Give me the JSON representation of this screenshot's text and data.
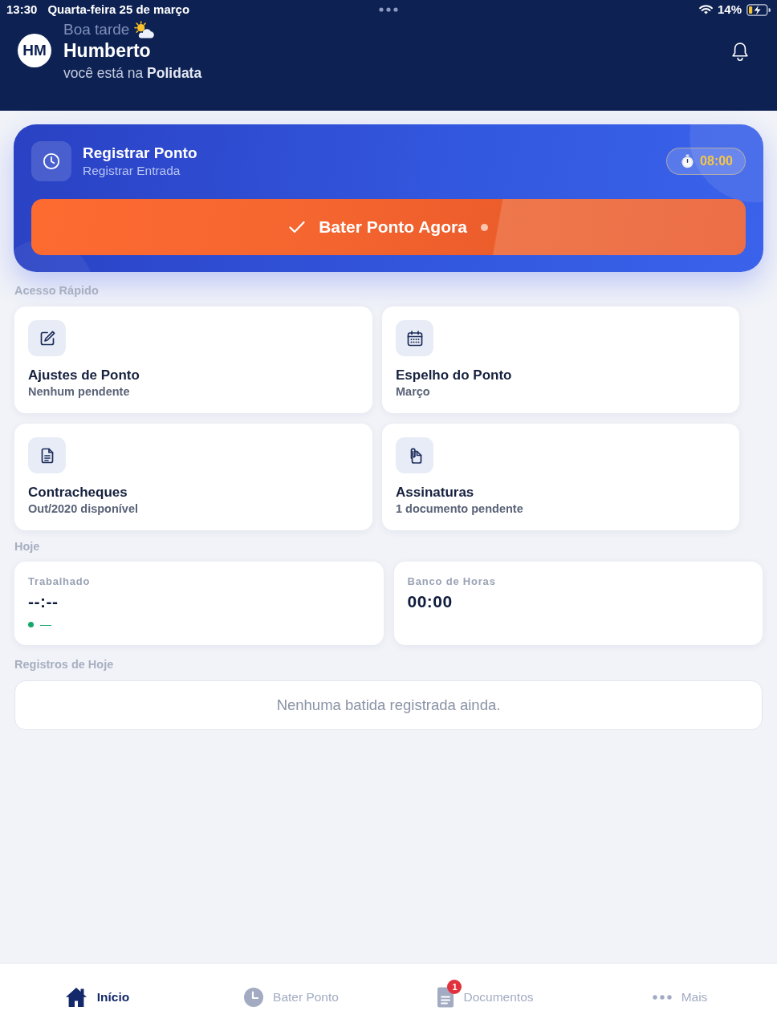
{
  "status_bar": {
    "time": "13:30",
    "date": "Quarta-feira 25 de março",
    "battery": "14%"
  },
  "header": {
    "initials": "HM",
    "greeting": "Boa tarde",
    "name": "Humberto",
    "subtitle": "você está na **Polidata**"
  },
  "punch_card": {
    "title": "Registrar Ponto",
    "subtitle": "Registrar Entrada",
    "time": "08:00",
    "button": "Bater Ponto Agora"
  },
  "quick_access": {
    "title": "Acesso Rápido",
    "items": [
      {
        "kind": "edit",
        "title": "Ajustes de Ponto",
        "subtitle": "Nenhum pendente"
      },
      {
        "kind": "calendar",
        "title": "Espelho do Ponto",
        "subtitle": "Março"
      },
      {
        "kind": "document",
        "title": "Contracheques",
        "subtitle": "Out/2020 disponível"
      },
      {
        "kind": "signature",
        "title": "Assinaturas",
        "subtitle": "1 documento pendente"
      }
    ]
  },
  "today": {
    "title": "Hoje",
    "stats": [
      {
        "label": "Trabalhado",
        "value": "--:--",
        "trend": "—"
      },
      {
        "label": "Banco de Horas",
        "value": "00:00"
      }
    ]
  },
  "records": {
    "title": "Registros de Hoje",
    "empty_message": "Nenhuma batida registrada ainda."
  },
  "tab_bar": {
    "items": [
      {
        "kind": "home",
        "label": "Início",
        "selected": true
      },
      {
        "kind": "clock",
        "label": "Bater Ponto",
        "selected": false
      },
      {
        "kind": "document",
        "label": "Documentos",
        "selected": false,
        "badge": "1"
      },
      {
        "kind": "more",
        "label": "Mais",
        "selected": false
      }
    ]
  }
}
